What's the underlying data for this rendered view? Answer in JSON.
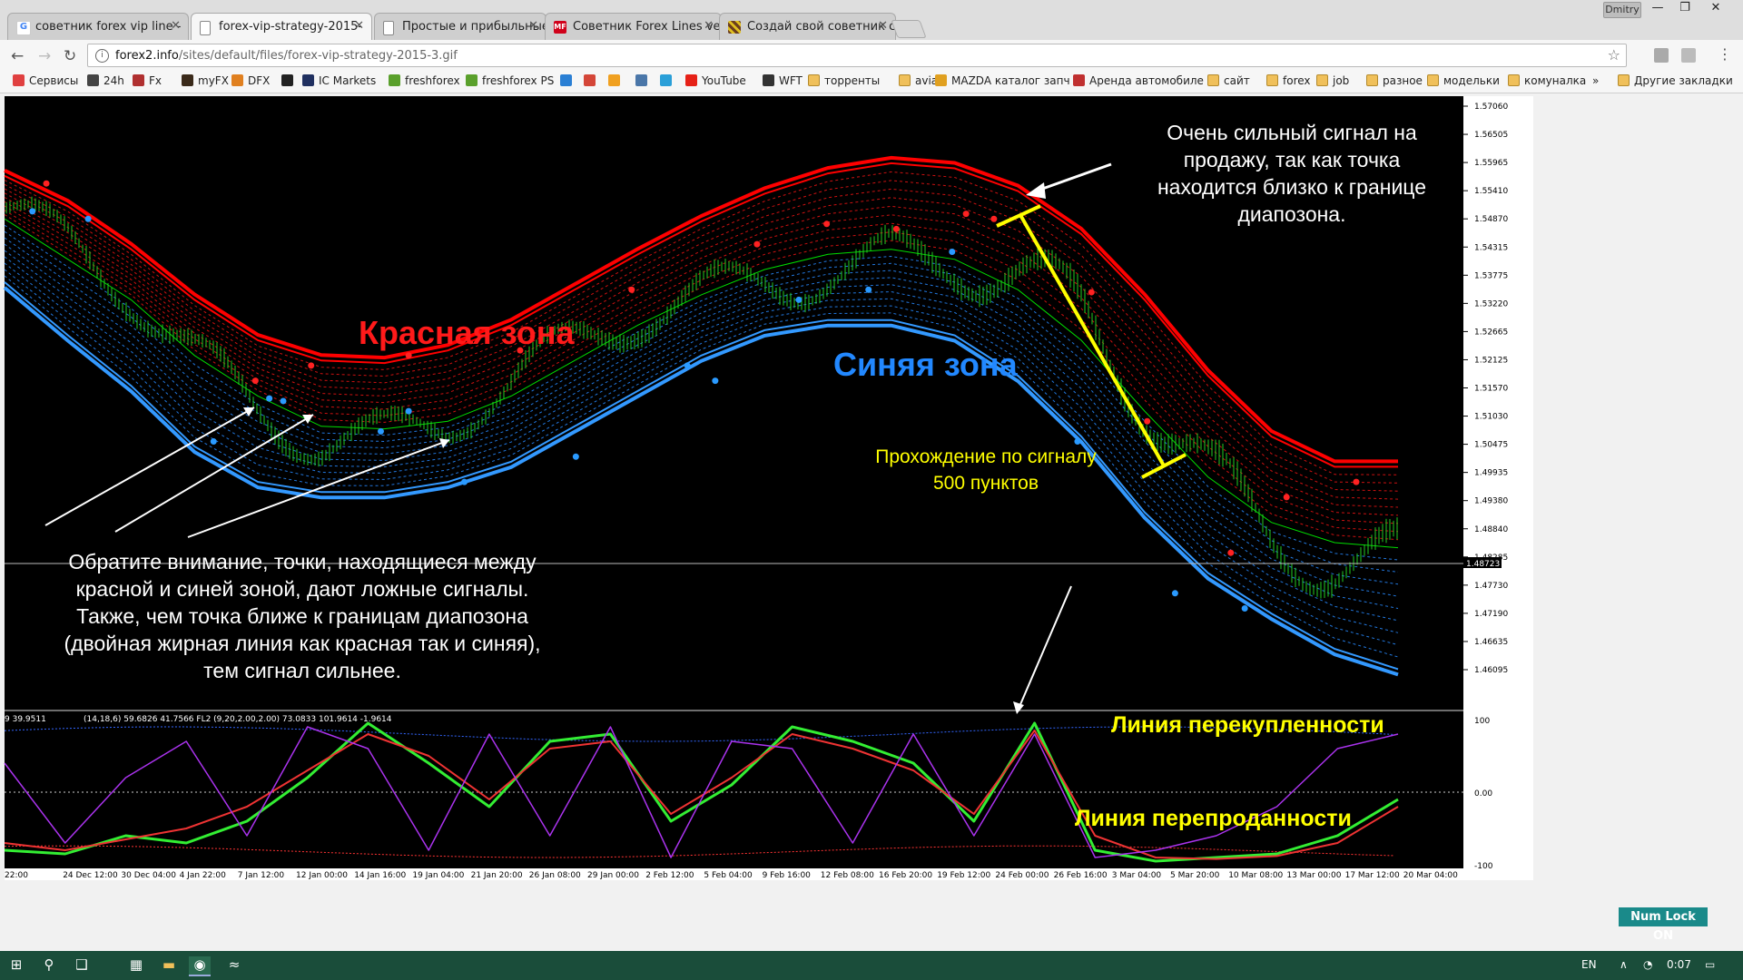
{
  "browser": {
    "tabs": [
      {
        "title": "советник forex vip line -",
        "icon_color": "#4285f4",
        "active": false
      },
      {
        "title": "forex-vip-strategy-2015-",
        "icon_color": "#888888",
        "active": true
      },
      {
        "title": "Простые и прибыльные",
        "icon_color": "#888888",
        "active": false
      },
      {
        "title": "Советник Forex Lines ve",
        "icon_color": "#d0021b",
        "active": false
      },
      {
        "title": "Создай свой советник с",
        "icon_color": "#6b3e1e",
        "active": false
      }
    ],
    "user_name": "Dmitry",
    "address": {
      "host": "forex2.info",
      "path": "/sites/default/files/forex-vip-strategy-2015-3.gif"
    },
    "bookmarks": [
      {
        "label": "Сервисы",
        "icon": "apps-icon",
        "color": "#e04040"
      },
      {
        "label": "24h",
        "icon": "site-icon",
        "color": "#444444"
      },
      {
        "label": "Fx",
        "icon": "site-icon",
        "color": "#b03030"
      },
      {
        "label": "myFX",
        "icon": "site-icon",
        "color": "#3a2a1a"
      },
      {
        "label": "DFX",
        "icon": "site-icon",
        "color": "#e08020"
      },
      {
        "label": "",
        "icon": "site-icon",
        "color": "#222222"
      },
      {
        "label": "IC Markets",
        "icon": "site-icon",
        "color": "#203060"
      },
      {
        "label": "freshforex",
        "icon": "site-icon",
        "color": "#5aa02c"
      },
      {
        "label": "freshforex PS",
        "icon": "site-icon",
        "color": "#5aa02c"
      },
      {
        "label": "",
        "icon": "site-icon",
        "color": "#2a7fd4"
      },
      {
        "label": "",
        "icon": "mail-icon",
        "color": "#d44638"
      },
      {
        "label": "",
        "icon": "mail-icon",
        "color": "#f0a020"
      },
      {
        "label": "",
        "icon": "vk-icon",
        "color": "#4a76a8"
      },
      {
        "label": "",
        "icon": "site-icon",
        "color": "#2a9fd8"
      },
      {
        "label": "YouTube",
        "icon": "youtube-icon",
        "color": "#e62117"
      },
      {
        "label": "WFT",
        "icon": "site-icon",
        "color": "#333333"
      },
      {
        "label": "торренты",
        "icon": "folder-icon",
        "color": "#f0c05a"
      },
      {
        "label": "avia",
        "icon": "folder-icon",
        "color": "#f0c05a"
      },
      {
        "label": "MAZDA каталог запч",
        "icon": "site-icon",
        "color": "#e0a020"
      },
      {
        "label": "Аренда автомобиле",
        "icon": "site-icon",
        "color": "#c03030"
      },
      {
        "label": "сайт",
        "icon": "folder-icon",
        "color": "#f0c05a"
      },
      {
        "label": "forex",
        "icon": "folder-icon",
        "color": "#f0c05a"
      },
      {
        "label": "job",
        "icon": "folder-icon",
        "color": "#f0c05a"
      },
      {
        "label": "разное",
        "icon": "folder-icon",
        "color": "#f0c05a"
      },
      {
        "label": "модельки",
        "icon": "folder-icon",
        "color": "#f0c05a"
      },
      {
        "label": "комуналка",
        "icon": "folder-icon",
        "color": "#f0c05a"
      }
    ],
    "bookmarks_more": "»",
    "other_bookmarks": "Другие закладки"
  },
  "chart_data": [
    {
      "type": "line",
      "y_axis_labels": [
        "1.57060",
        "1.56505",
        "1.55965",
        "1.55410",
        "1.54870",
        "1.54315",
        "1.53775",
        "1.53220",
        "1.52665",
        "1.52125",
        "1.51570",
        "1.51030",
        "1.50475",
        "1.49935",
        "1.49380",
        "1.48840",
        "1.48285",
        "1.47730",
        "1.47190",
        "1.46635",
        "1.46095"
      ],
      "current_price": "1.48723",
      "x_axis_labels": [
        "22:00",
        "24 Dec 12:00",
        "30 Dec 04:00",
        "4 Jan 22:00",
        "7 Jan 12:00",
        "12 Jan 00:00",
        "14 Jan 16:00",
        "19 Jan 04:00",
        "21 Jan 20:00",
        "26 Jan 08:00",
        "29 Jan 00:00",
        "2 Feb 12:00",
        "5 Feb 04:00",
        "9 Feb 16:00",
        "12 Feb 08:00",
        "16 Feb 20:00",
        "19 Feb 12:00",
        "24 Feb 00:00",
        "26 Feb 16:00",
        "3 Mar 04:00",
        "5 Mar 20:00",
        "10 Mar 08:00",
        "13 Mar 00:00",
        "17 Mar 12:00",
        "20 Mar 04:00"
      ],
      "series": [
        {
          "color": "#ff0000",
          "values": [
            1.5585,
            1.5525,
            1.544,
            1.534,
            1.526,
            1.522,
            1.5215,
            1.524,
            1.529,
            1.536,
            1.543,
            1.5495,
            1.555,
            1.559,
            1.561,
            1.56,
            1.5555,
            1.547,
            1.534,
            1.519,
            1.507,
            1.501,
            1.501
          ]
        },
        {
          "color": "#00dd00",
          "values": [
            1.55,
            1.542,
            1.534,
            1.523,
            1.515,
            1.509,
            1.5085,
            1.51,
            1.515,
            1.522,
            1.529,
            1.535,
            1.54,
            1.543,
            1.544,
            1.542,
            1.536,
            1.526,
            1.512,
            1.499,
            1.49,
            1.486,
            1.485
          ]
        },
        {
          "color": "#3399ff",
          "values": [
            1.5375,
            1.527,
            1.517,
            1.505,
            1.498,
            1.496,
            1.496,
            1.498,
            1.502,
            1.509,
            1.516,
            1.523,
            1.528,
            1.53,
            1.53,
            1.527,
            1.519,
            1.507,
            1.492,
            1.48,
            1.472,
            1.465,
            1.461
          ]
        }
      ],
      "ylim": [
        1.46,
        1.573
      ],
      "up_signals": [
        [
          0.03,
          1.557
        ],
        [
          0.18,
          1.518
        ],
        [
          0.22,
          1.521
        ],
        [
          0.29,
          1.523
        ],
        [
          0.37,
          1.524
        ],
        [
          0.45,
          1.536
        ],
        [
          0.54,
          1.545
        ],
        [
          0.59,
          1.549
        ],
        [
          0.64,
          1.548
        ],
        [
          0.69,
          1.551
        ],
        [
          0.71,
          1.55
        ],
        [
          0.78,
          1.5355
        ],
        [
          0.82,
          1.51
        ],
        [
          0.88,
          1.484
        ],
        [
          0.92,
          1.495
        ],
        [
          0.97,
          1.498
        ]
      ],
      "down_signals": [
        [
          0.02,
          1.5515
        ],
        [
          0.06,
          1.55
        ],
        [
          0.15,
          1.506
        ],
        [
          0.19,
          1.5145
        ],
        [
          0.2,
          1.514
        ],
        [
          0.27,
          1.508
        ],
        [
          0.29,
          1.512
        ],
        [
          0.33,
          1.498
        ],
        [
          0.41,
          1.503
        ],
        [
          0.49,
          1.521
        ],
        [
          0.51,
          1.518
        ],
        [
          0.57,
          1.534
        ],
        [
          0.62,
          1.536
        ],
        [
          0.68,
          1.5435
        ],
        [
          0.77,
          1.506
        ],
        [
          0.84,
          1.476
        ],
        [
          0.89,
          1.473
        ]
      ]
    },
    {
      "type": "line",
      "header": "(14,18,6) 59.6826 41.7566   FL2 (9,20,2.00,2.00) 73.0833 101.9614 -1.9614",
      "header_left": "9 39.9511",
      "y_axis_labels": [
        "100",
        "0.00",
        "-100"
      ],
      "ylim": [
        -100,
        100
      ],
      "series": [
        {
          "color": "#33ee33",
          "values": [
            -80,
            -85,
            -60,
            -70,
            -40,
            20,
            95,
            40,
            -20,
            70,
            80,
            -40,
            10,
            90,
            70,
            40,
            -40,
            95,
            -80,
            -95,
            -90,
            -85,
            -60,
            -10
          ]
        },
        {
          "color": "#ee3333",
          "values": [
            -70,
            -80,
            -65,
            -50,
            -20,
            30,
            80,
            50,
            -10,
            60,
            70,
            -30,
            20,
            80,
            60,
            30,
            -30,
            85,
            -60,
            -90,
            -92,
            -88,
            -70,
            -20
          ]
        },
        {
          "color": "#aa33ee",
          "values": [
            40,
            -70,
            20,
            70,
            -60,
            90,
            60,
            -80,
            80,
            -60,
            90,
            -90,
            70,
            60,
            -70,
            80,
            -60,
            80,
            -90,
            -80,
            -60,
            -20,
            60,
            80
          ]
        }
      ]
    }
  ],
  "annotations": {
    "red_zone": "Красная зона",
    "blue_zone": "Синяя зона",
    "strong_signal": [
      "Очень сильный сигнал на",
      "продажу, так как точка",
      "находится близко к границе",
      "диапозона."
    ],
    "passage": [
      "Прохождение по сигналу",
      "500 пунктов"
    ],
    "note": [
      "Обратите внимание, точки, находящиеся между",
      "красной и синей зоной, дают ложные сигналы.",
      "Также, чем точка ближе к границам диапозона",
      "(двойная жирная линия как красная так и синяя),",
      "тем сигнал сильнее."
    ],
    "overbought": "Линия перекупленности",
    "oversold": "Линия перепроданности"
  },
  "status": {
    "num_lock": "Num Lock ON"
  },
  "taskbar": {
    "lang": "EN",
    "time": "0:07"
  },
  "colors": {
    "chart_bg": "#000000",
    "accent_yellow": "#ffff00",
    "red": "#ff0000",
    "blue": "#3399ff"
  }
}
